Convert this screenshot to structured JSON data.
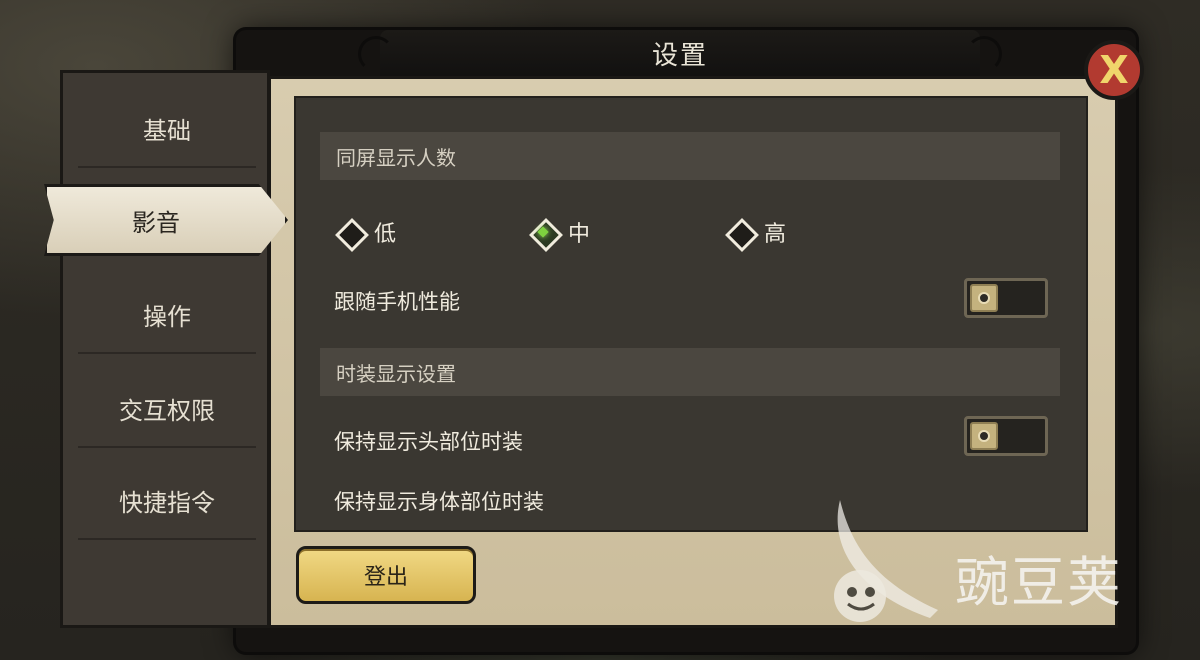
{
  "title": "设置",
  "close_icon": "close-x-icon",
  "sidebar": {
    "tabs": [
      {
        "label": "基础",
        "active": false
      },
      {
        "label": "影音",
        "active": true
      },
      {
        "label": "操作",
        "active": false
      },
      {
        "label": "交互权限",
        "active": false
      },
      {
        "label": "快捷指令",
        "active": false
      }
    ]
  },
  "sections": {
    "display_count": {
      "header": "同屏显示人数",
      "options": [
        "低",
        "中",
        "高"
      ],
      "selected": "中",
      "follow_perf_label": "跟随手机性能",
      "follow_perf_on": false
    },
    "costume": {
      "header": "时装显示设置",
      "keep_head_label": "保持显示头部位时装",
      "keep_head_on": false,
      "keep_body_label": "保持显示身体部位时装"
    }
  },
  "logout_label": "登出",
  "watermark": {
    "text": "豌豆荚"
  },
  "colors": {
    "accent_green": "#7ed13f",
    "button_gold": "#e3c56a",
    "close_red": "#b23a30"
  }
}
